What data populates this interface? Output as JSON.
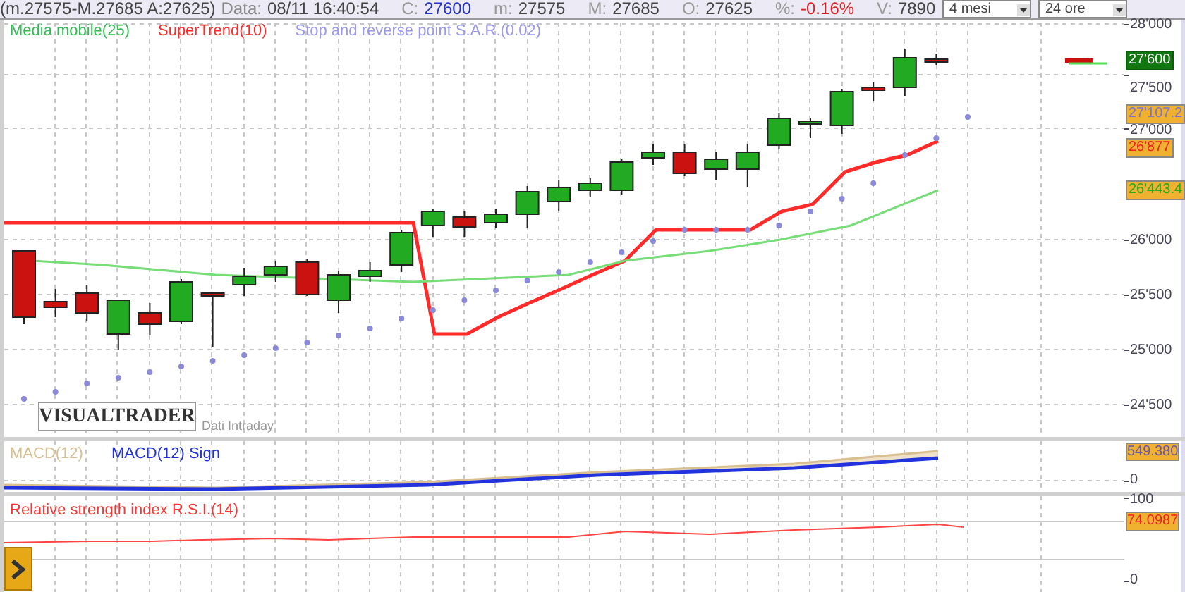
{
  "header": {
    "quote": "(m.27575-M.27685 A:27625)",
    "date_label": "Data:",
    "date": "08/11 16:40:54",
    "fields": [
      {
        "label": "C:",
        "value": "27600",
        "color": "#2233cc"
      },
      {
        "label": "m:",
        "value": "27575",
        "color": "#444444"
      },
      {
        "label": "M:",
        "value": "27685",
        "color": "#444444"
      },
      {
        "label": "O:",
        "value": "27625",
        "color": "#444444"
      },
      {
        "label": "%:",
        "value": "-0.16%",
        "color": "#e02020"
      },
      {
        "label": "V:",
        "value": "7890",
        "color": "#444444"
      }
    ],
    "period": "4 mesi",
    "interval": "24 ore"
  },
  "price_pane": {
    "legend": [
      {
        "label": "Media mobile(25)",
        "color": "#33bb55"
      },
      {
        "label": "SuperTrend(10)",
        "color": "#ff2a2a"
      },
      {
        "label": "Stop and reverse point S.A.R.(0.02)",
        "color": "#9999ee"
      }
    ],
    "logo": "VISUALTRADER",
    "note": "Dati Intraday",
    "axis_labels": [
      "28'000",
      "27'500",
      "27'000",
      "26'000",
      "25'500",
      "25'000",
      "24'500"
    ],
    "markers": [
      {
        "text": "27'600",
        "kind": "last"
      },
      {
        "text": "27'107.2",
        "kind": "sar"
      },
      {
        "text": "26'877",
        "kind": "supertrend"
      },
      {
        "text": "26'443.4",
        "kind": "average"
      }
    ]
  },
  "macd_pane": {
    "legend": [
      {
        "label": "MACD(12)",
        "color": "#d8bf8f"
      },
      {
        "label": "MACD(12) Sign",
        "color": "#2233dd"
      }
    ],
    "marker": "549.380",
    "axis_labels": [
      "0"
    ]
  },
  "rsi_pane": {
    "legend": [
      {
        "label": "Relative strength index R.S.I.(14)",
        "color": "#ff3333"
      }
    ],
    "marker": "74.0987",
    "axis_labels": [
      "100",
      "0"
    ]
  }
}
